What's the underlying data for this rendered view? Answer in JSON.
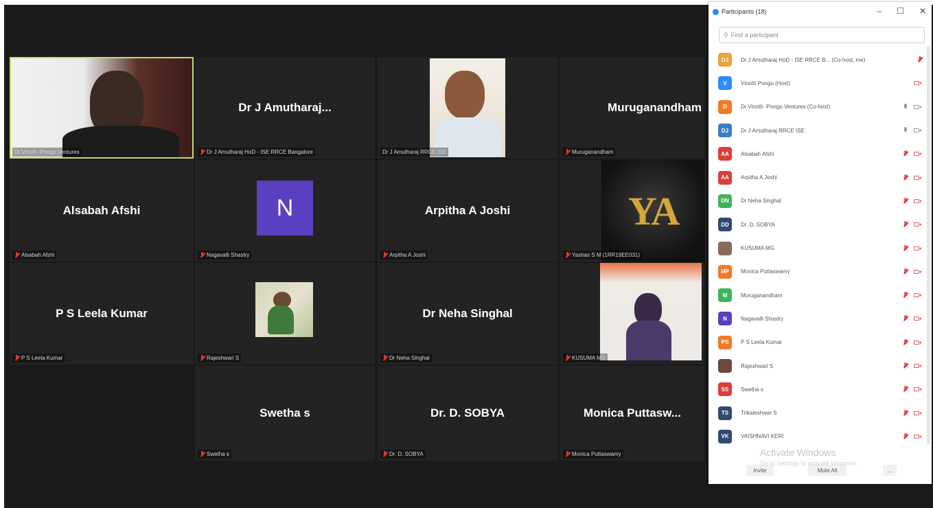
{
  "tiles": [
    {
      "display": "video",
      "label": "Dr.Vinoth -Pongu Ventures",
      "active": true,
      "muted": false
    },
    {
      "display": "name",
      "center": "Dr J Amutharaj...",
      "label": "Dr J Amutharaj HoD - ISE RRCE Bangalore",
      "muted": true
    },
    {
      "display": "video",
      "label": "Dr J Amutharaj RRCE ISE",
      "muted": false
    },
    {
      "display": "name",
      "center": "Muruganandham",
      "label": "Muruganandham",
      "muted": true
    },
    {
      "display": "name",
      "center": "Alsabah Afshi",
      "label": "Alsabah Afshi",
      "muted": true
    },
    {
      "display": "avatar",
      "avatar_letter": "N",
      "label": "Nagavalli Shastry",
      "muted": true
    },
    {
      "display": "name",
      "center": "Arpitha A Joshi",
      "label": "Arpitha A Joshi",
      "muted": true
    },
    {
      "display": "logo",
      "logo_text": "YA",
      "label": "Yashas S M (1RR19EE031)",
      "muted": true
    },
    {
      "display": "name",
      "center": "P S Leela Kumar",
      "label": "P S Leela Kumar",
      "muted": true
    },
    {
      "display": "photo",
      "label": "Rajeshwari S",
      "muted": true
    },
    {
      "display": "name",
      "center": "Dr Neha Singhal",
      "label": "Dr Neha Singhal",
      "muted": true
    },
    {
      "display": "photo",
      "label": "KUSUMA MG",
      "muted": true
    },
    {
      "display": "name",
      "center": "Swetha s",
      "label": "Swetha s",
      "muted": true
    },
    {
      "display": "name",
      "center": "Dr. D. SOBYA",
      "label": "Dr. D. SOBYA",
      "muted": true
    },
    {
      "display": "name",
      "center": "Monica  Puttasw...",
      "label": "Monica Puttaswamy",
      "muted": true
    }
  ],
  "panel": {
    "title": "Participants (18)",
    "window_buttons": [
      "–",
      "☐",
      "✕"
    ],
    "search_placeholder": "Find a participant",
    "participants": [
      {
        "initials": "DJ",
        "color": "#e8a53a",
        "name": "Dr J Amutharaj HoD - ISE RRCE B... (Co-host, me)",
        "mic": "muted",
        "cam": "none"
      },
      {
        "initials": "V",
        "color": "#2d8cff",
        "name": "Vinoth Pongu (Host)",
        "mic": "none",
        "cam": "off"
      },
      {
        "initials": "D",
        "color": "#f07a27",
        "name": "Dr.Vinoth -Pongu Ventures (Co-host)",
        "mic": "on",
        "cam": "on"
      },
      {
        "initials": "DJ",
        "color": "#3a7fc4",
        "name": "Dr J Amutharaj RRCE ISE",
        "mic": "on",
        "cam": "on"
      },
      {
        "initials": "AA",
        "color": "#d9403a",
        "name": "Alsabah Afshi",
        "mic": "muted",
        "cam": "off"
      },
      {
        "initials": "AA",
        "color": "#d9403a",
        "name": "Arpitha A Joshi",
        "mic": "muted",
        "cam": "off"
      },
      {
        "initials": "DN",
        "color": "#3fb45a",
        "name": "Dr Neha Singhal",
        "mic": "muted",
        "cam": "off"
      },
      {
        "initials": "DD",
        "color": "#2f4a6e",
        "name": "Dr. D. SOBYA",
        "mic": "muted",
        "cam": "off"
      },
      {
        "initials": "",
        "color": "#8a6a5a",
        "name": "KUSUMA MG",
        "mic": "muted",
        "cam": "off"
      },
      {
        "initials": "MP",
        "color": "#f07a27",
        "name": "Monica Puttaswamy",
        "mic": "muted",
        "cam": "off"
      },
      {
        "initials": "M",
        "color": "#3fb45a",
        "name": "Muruganandham",
        "mic": "muted",
        "cam": "off"
      },
      {
        "initials": "N",
        "color": "#5a3fc0",
        "name": "Nagavalli Shastry",
        "mic": "muted",
        "cam": "off"
      },
      {
        "initials": "PS",
        "color": "#f07a27",
        "name": "P S Leela Kumar",
        "mic": "muted",
        "cam": "off"
      },
      {
        "initials": "",
        "color": "#6a4a3a",
        "name": "Rajeshwari S",
        "mic": "muted",
        "cam": "off"
      },
      {
        "initials": "SS",
        "color": "#d9403a",
        "name": "Swetha s",
        "mic": "muted",
        "cam": "off"
      },
      {
        "initials": "TS",
        "color": "#2f4a6e",
        "name": "Trikaleshwar S",
        "mic": "muted",
        "cam": "off"
      },
      {
        "initials": "VK",
        "color": "#2f4a6e",
        "name": "VAISHNAVI KERI",
        "mic": "muted",
        "cam": "off"
      }
    ],
    "invite_label": "Invite",
    "mute_all_label": "Mute All",
    "more_label": "..."
  },
  "watermark": {
    "line1": "Activate Windows",
    "line2": "Go to Settings to activate Windows."
  },
  "colors": {
    "background": "#1a1a1a",
    "tile": "#232323",
    "active_border": "#c9d96a",
    "muted": "#e53935",
    "avatar_n": "#5a3fc0"
  }
}
